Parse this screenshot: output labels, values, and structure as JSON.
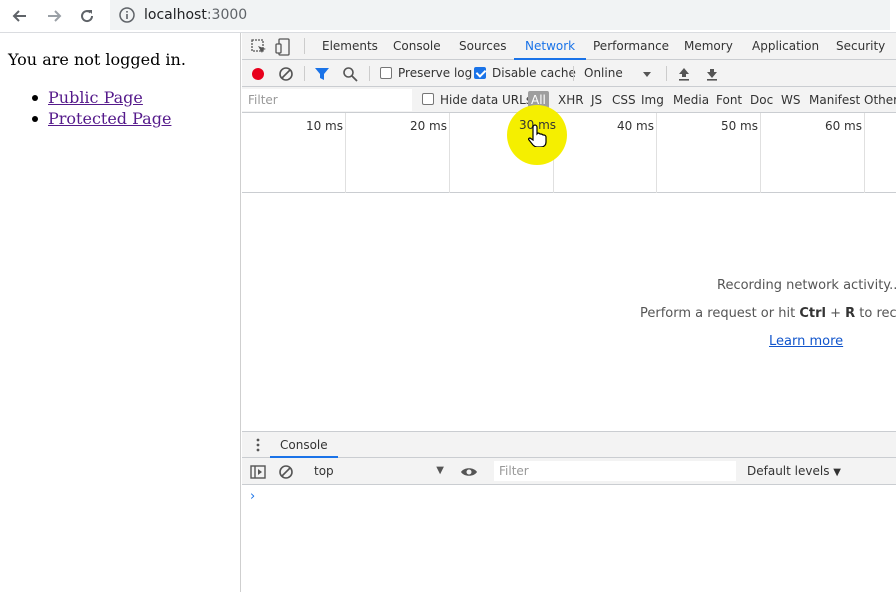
{
  "browser": {
    "url_host": "localhost",
    "url_port": ":3000",
    "icons": [
      "back-arrow-icon",
      "forward-arrow-icon",
      "reload-icon",
      "info-icon"
    ]
  },
  "page": {
    "status": "You are not logged in.",
    "links": [
      "Public Page",
      "Protected Page"
    ]
  },
  "devtools": {
    "tabs": [
      "Elements",
      "Console",
      "Sources",
      "Network",
      "Performance",
      "Memory",
      "Application",
      "Security"
    ],
    "active_tab": "Network",
    "toolbar": {
      "preserve_log": "Preserve log",
      "preserve_log_checked": false,
      "disable_cache": "Disable cache",
      "disable_cache_checked": true,
      "throttle": "Online"
    },
    "filter": {
      "placeholder": "Filter",
      "hide_data_urls": "Hide data URLs",
      "types": [
        "All",
        "XHR",
        "JS",
        "CSS",
        "Img",
        "Media",
        "Font",
        "Doc",
        "WS",
        "Manifest",
        "Other"
      ],
      "active_type": "All"
    },
    "timeline": {
      "ticks": [
        "10 ms",
        "20 ms",
        "30 ms",
        "40 ms",
        "50 ms",
        "60 ms"
      ]
    },
    "empty_state": {
      "line1": "Recording network activity...",
      "line2_prefix": "Perform a request or hit ",
      "line2_key1": "Ctrl",
      "line2_plus": " + ",
      "line2_key2": "R",
      "line2_suffix": " to record",
      "learn_more": "Learn more"
    },
    "drawer": {
      "tab": "Console",
      "context": "top",
      "filter_placeholder": "Filter",
      "levels": "Default levels",
      "prompt": "›"
    }
  },
  "colors": {
    "accent": "#1a73e8",
    "record": "#e8001c",
    "visited_link": "#551a8b",
    "cursor_highlight": "#f5ef00"
  }
}
